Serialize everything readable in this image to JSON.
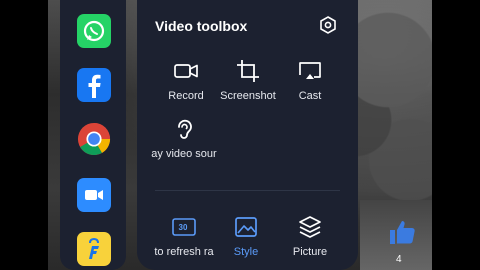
{
  "toolbox": {
    "title": "Video toolbox",
    "tools": [
      {
        "label": "Record",
        "icon": "video-camera-icon"
      },
      {
        "label": "Screenshot",
        "icon": "crop-icon"
      },
      {
        "label": "Cast",
        "icon": "cast-icon"
      },
      {
        "label": "ay video sour",
        "icon": "ear-icon"
      }
    ],
    "bottom_tools": [
      {
        "label": "to refresh ra",
        "icon": "refresh-rate-icon",
        "badge": "30"
      },
      {
        "label": "Style",
        "icon": "style-image-icon"
      },
      {
        "label": "Picture",
        "icon": "layers-icon"
      }
    ]
  },
  "apps": [
    {
      "name": "WhatsApp",
      "icon": "whatsapp-icon",
      "color": "#25D366"
    },
    {
      "name": "Facebook",
      "icon": "facebook-icon",
      "color": "#1877F2"
    },
    {
      "name": "Chrome",
      "icon": "chrome-icon",
      "color": "#ffffff"
    },
    {
      "name": "Zoom",
      "icon": "zoom-icon",
      "color": "#2D8CFF"
    },
    {
      "name": "Flipkart",
      "icon": "flipkart-icon",
      "color": "#F8D23B"
    }
  ],
  "like": {
    "count": "4",
    "color": "#3b7be0"
  },
  "colors": {
    "panel": "#1c2130",
    "accent": "#3b7be0"
  }
}
